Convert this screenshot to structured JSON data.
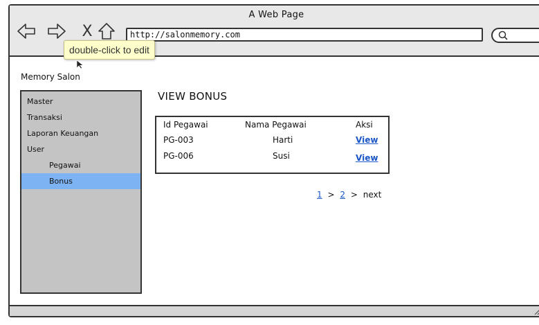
{
  "window": {
    "title": "A Web Page"
  },
  "browser": {
    "url": "http://salonmemory.com",
    "stop_glyph": "X",
    "tooltip": "double-click to edit"
  },
  "site": {
    "title": "Memory Salon"
  },
  "sidebar": {
    "items": [
      {
        "label": "Master",
        "level": 0,
        "active": false
      },
      {
        "label": "Transaksi",
        "level": 0,
        "active": false
      },
      {
        "label": "Laporan Keuangan",
        "level": 0,
        "active": false
      },
      {
        "label": "User",
        "level": 0,
        "active": false
      },
      {
        "label": "Pegawai",
        "level": 1,
        "active": false
      },
      {
        "label": "Bonus",
        "level": 1,
        "active": true
      }
    ]
  },
  "main": {
    "heading": "VIEW BONUS",
    "table": {
      "headers": [
        "Id Pegawai",
        "Nama Pegawai",
        "Aksi"
      ],
      "rows": [
        {
          "id": "PG-003",
          "name": "Harti",
          "action": "View"
        },
        {
          "id": "PG-006",
          "name": "Susi",
          "action": "View"
        }
      ]
    },
    "pagination": {
      "page1": "1",
      "sep1": ">",
      "page2": "2",
      "sep2": ">",
      "next": "next"
    }
  },
  "colors": {
    "active_item": "#7eb3f3",
    "sidebar_bg": "#c4c4c4",
    "link": "#1a56c7",
    "tooltip_bg": "#ffffcc"
  }
}
